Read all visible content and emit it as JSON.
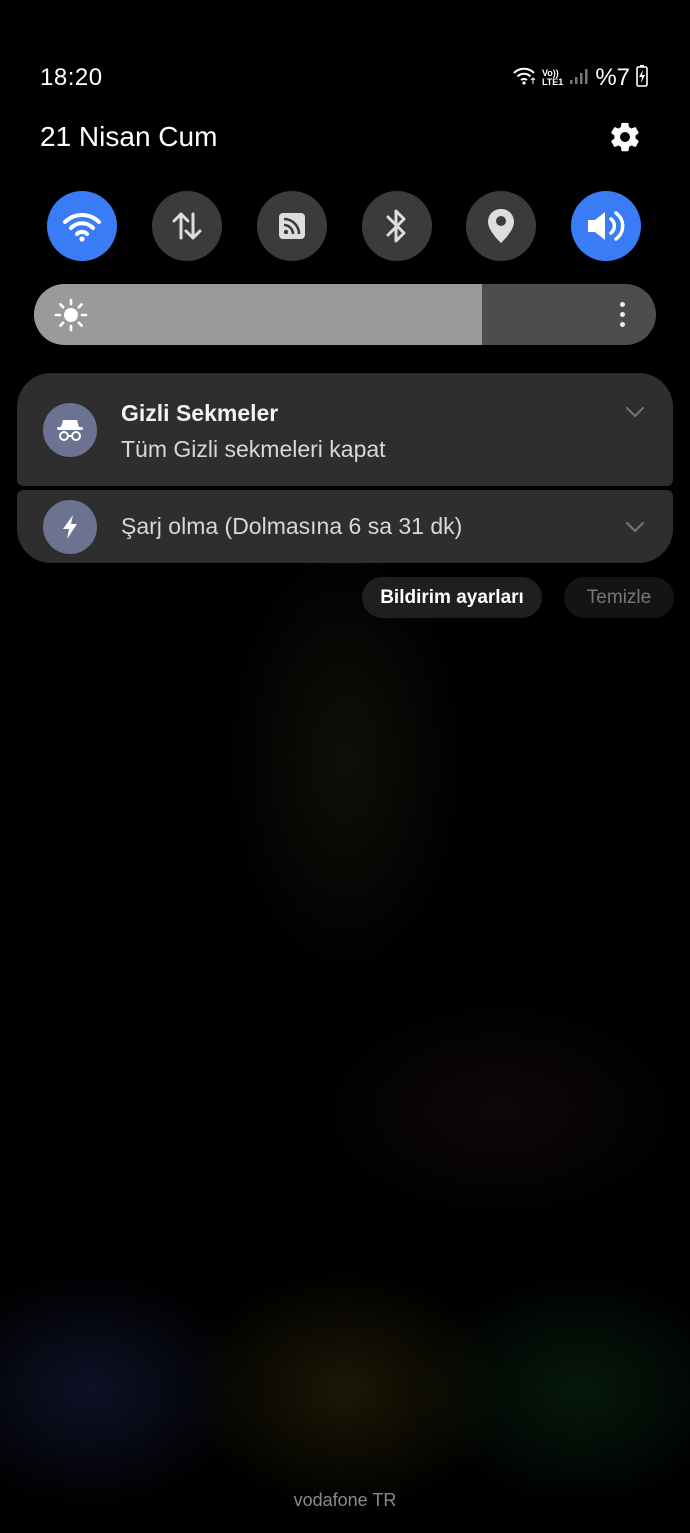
{
  "status_bar": {
    "time": "18:20",
    "network_label_top": "Vo))",
    "network_label_bottom": "LTE1",
    "battery_percent": "%7",
    "battery_level": 0.07,
    "icons": [
      "wifi-icon",
      "signal-icon",
      "battery-charging-icon"
    ]
  },
  "header": {
    "date": "21 Nisan Cum",
    "settings_icon": "gear-icon"
  },
  "quick_toggles": [
    {
      "name": "wifi",
      "icon": "wifi-icon",
      "active": true
    },
    {
      "name": "mobile-data",
      "icon": "data-transfer-icon",
      "active": false
    },
    {
      "name": "cast",
      "icon": "cast-icon",
      "active": false
    },
    {
      "name": "bluetooth",
      "icon": "bluetooth-icon",
      "active": false
    },
    {
      "name": "location",
      "icon": "location-pin-icon",
      "active": false
    },
    {
      "name": "sound",
      "icon": "speaker-icon",
      "active": true
    }
  ],
  "brightness": {
    "level": 0.72,
    "icon": "sun-icon"
  },
  "notifications": [
    {
      "app_icon": "incognito-icon",
      "title": "Gizli Sekmeler",
      "text": "Tüm Gizli sekmeleri kapat"
    },
    {
      "app_icon": "lightning-icon",
      "title": "",
      "text": "Şarj olma (Dolmasına 6 sa 31 dk)"
    }
  ],
  "actions": {
    "notification_settings": "Bildirim ayarları",
    "clear": "Temizle"
  },
  "carrier": "vodafone TR",
  "colors": {
    "accent": "#3a7cf6",
    "toggle_off": "#3b3b3b",
    "card": "#2e2e2e"
  }
}
